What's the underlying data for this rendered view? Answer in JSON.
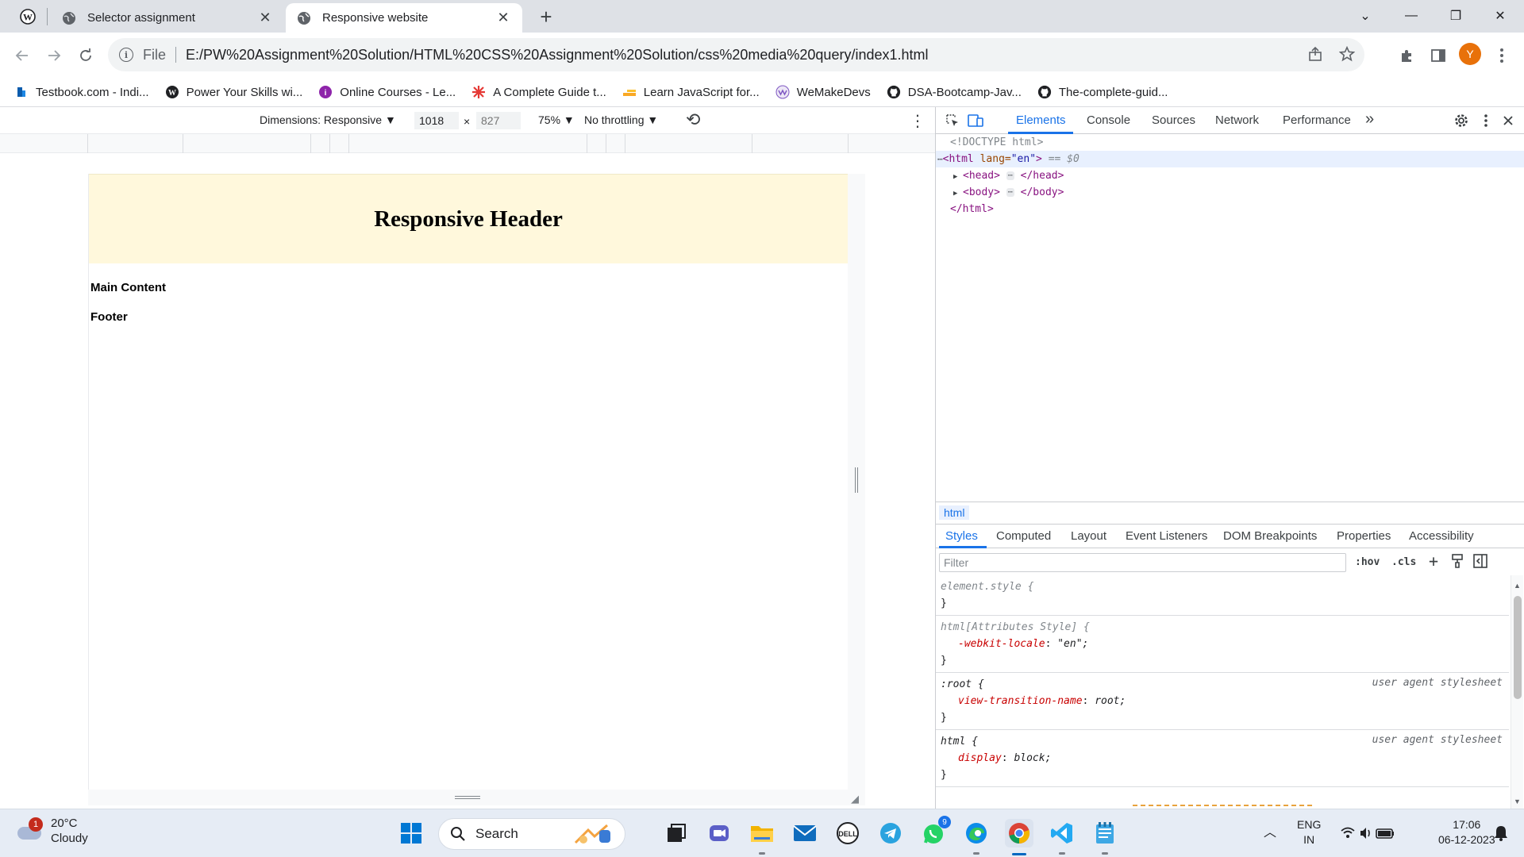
{
  "browser": {
    "tabs": [
      {
        "title": "Selector assignment",
        "active": false
      },
      {
        "title": "Responsive website",
        "active": true
      }
    ],
    "close_glyph": "✕",
    "new_tab_glyph": "+",
    "window_controls": {
      "dropdown": "⌄",
      "minimize": "—",
      "restore": "❐",
      "close": "✕"
    },
    "address": {
      "scheme_label": "File",
      "url": "E:/PW%20Assignment%20Solution/HTML%20CSS%20Assignment%20Solution/css%20media%20query/index1.html"
    },
    "avatar_letter": "Y",
    "bookmarks": [
      {
        "label": "Testbook.com - Indi...",
        "icon": "testbook-icon",
        "color": "#0b5cad"
      },
      {
        "label": "Power Your Skills wi...",
        "icon": "skills-icon",
        "color": "#202124"
      },
      {
        "label": "Online Courses - Le...",
        "icon": "courses-icon",
        "color": "#8e24aa"
      },
      {
        "label": "A Complete Guide t...",
        "icon": "asterisk-icon",
        "color": "#e53935"
      },
      {
        "label": "Learn JavaScript for...",
        "icon": "js-icon",
        "color": "#f9a825"
      },
      {
        "label": "WeMakeDevs",
        "icon": "wemakedevs-icon",
        "color": "#7e57c2"
      },
      {
        "label": "DSA-Bootcamp-Jav...",
        "icon": "github-icon",
        "color": "#202124"
      },
      {
        "label": "The-complete-guid...",
        "icon": "github-icon",
        "color": "#202124"
      }
    ]
  },
  "device_toolbar": {
    "dimensions_label": "Dimensions: Responsive ▼",
    "width_value": "1018",
    "times": "×",
    "height_placeholder": "827",
    "zoom_label": "75% ▼",
    "throttling_label": "No throttling ▼",
    "rotate_glyph": "⟲",
    "more_glyph": "⋮"
  },
  "emulated_page": {
    "header": "Responsive Header",
    "main": "Main Content",
    "footer": "Footer"
  },
  "devtools": {
    "tabs": [
      "Elements",
      "Console",
      "Sources",
      "Network",
      "Performance"
    ],
    "active_tab": "Elements",
    "more_tabs_glyph": "»",
    "dom": {
      "doctype": "<!DOCTYPE html>",
      "html_open_tag": "<html",
      "lang_attr": " lang=",
      "lang_value": "\"en\"",
      "html_close_bracket": ">",
      "selected_marker": " == $0",
      "head_open": "<head>",
      "head_close": "</head>",
      "body_open": "<body>",
      "body_close": "</body>",
      "html_close": "</html>",
      "ellipsis": "⋯"
    },
    "breadcrumb": "html",
    "sub_tabs": [
      "Styles",
      "Computed",
      "Layout",
      "Event Listeners",
      "DOM Breakpoints",
      "Properties",
      "Accessibility"
    ],
    "filter_placeholder": "Filter",
    "filter_buttons": {
      "hov": ":hov",
      "cls": ".cls",
      "plus": "+"
    },
    "rules": [
      {
        "selector": "element.style {",
        "origin": "",
        "prop": "",
        "value": "",
        "close": "}"
      },
      {
        "selector": "html[Attributes Style] {",
        "origin": "",
        "prop": "-webkit-locale",
        "value": "\"en\";",
        "close": "}"
      },
      {
        "selector": ":root {",
        "origin": "user agent stylesheet",
        "prop": "view-transition-name",
        "value": "root;",
        "close": "}"
      },
      {
        "selector": "html {",
        "origin": "user agent stylesheet",
        "prop": "display",
        "value": "block;",
        "close": "}"
      }
    ]
  },
  "taskbar": {
    "weather_temp": "20°C",
    "weather_desc": "Cloudy",
    "weather_badge": "1",
    "search_label": "Search",
    "whatsapp_badge": "9",
    "lang_line1": "ENG",
    "lang_line2": "IN",
    "time": "17:06",
    "date": "06-12-2023"
  }
}
